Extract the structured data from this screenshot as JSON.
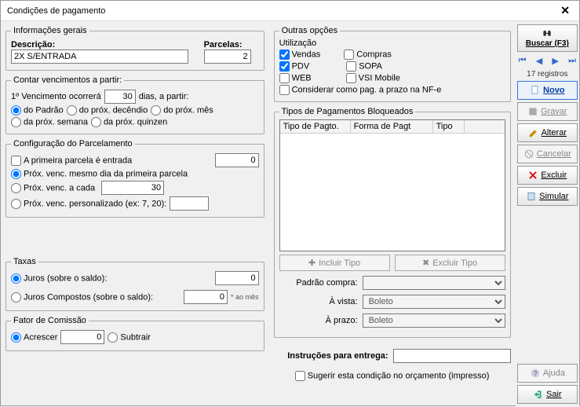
{
  "window": {
    "title": "Condições de pagamento"
  },
  "left": {
    "group_info": "Informações gerais",
    "descricao_label": "Descrição:",
    "descricao_value": "2X S/ENTRADA",
    "parcelas_label": "Parcelas:",
    "parcelas_value": "2",
    "group_contar": "Contar vencimentos a partir:",
    "primeiro_label_a": "1º Vencimento ocorrerá",
    "primeiro_days": "30",
    "primeiro_label_b": "dias, a partir:",
    "rad_padrao": "do Padrão",
    "rad_prox_dec": "do próx. decêndio",
    "rad_prox_mes": "do próx. mês",
    "rad_prox_sem": "da próx. semana",
    "rad_prox_quin": "da próx. quinzen",
    "group_parcel": "Configuração do Parcelamento",
    "chk_primeira_entrada": "A primeira parcela é entrada",
    "primeira_entrada_val": "0",
    "rad_mesmo_dia": "Próx. venc. mesmo dia da primeira parcela",
    "rad_acada": "Próx. venc. a cada",
    "acada_val": "30",
    "rad_personalizado": "Próx. venc. personalizado (ex: 7, 20):",
    "personalizado_val": "",
    "group_taxas": "Taxas",
    "rad_juros": "Juros (sobre o saldo):",
    "juros_val": "0",
    "rad_juros_comp": "Juros Compostos (sobre o saldo):",
    "juros_comp_val": "0",
    "ao_mes": "* ao mês",
    "group_fator": "Fator de Comissão",
    "rad_acrescer": "Acrescer",
    "fator_val": "0",
    "rad_subtrair": "Subtrair"
  },
  "mid": {
    "group_outras": "Outras opções",
    "utilizacao": "Utilização",
    "chk_vendas": "Vendas",
    "chk_compras": "Compras",
    "chk_pdv": "PDV",
    "chk_sopa": "SOPA",
    "chk_web": "WEB",
    "chk_vsi": "VSI Mobile",
    "chk_prazo_nfe": "Considerar como pag. a prazo na NF-e",
    "group_tipos": "Tipos de Pagamentos Bloqueados",
    "col1": "Tipo de Pagto.",
    "col2": "Forma de Pagt",
    "col3": "Tipo",
    "btn_incluir": "Incluir Tipo",
    "btn_excluir": "Excluir Tipo",
    "padrao_compra": "Padrão compra:",
    "padrao_compra_val": "",
    "a_vista": "À vista:",
    "a_vista_val": "Boleto",
    "a_prazo": "À prazo:",
    "a_prazo_val": "Boleto",
    "instr_label": "Instruções para entrega:",
    "instr_val": "",
    "chk_sugerir": "Sugerir esta condição no orçamento (impresso)"
  },
  "side": {
    "buscar": "Buscar (F3)",
    "registros": "17 registros",
    "novo": "Novo",
    "gravar": "Gravar",
    "alterar": "Alterar",
    "cancelar": "Cancelar",
    "excluir": "Excluir",
    "simular": "Simular",
    "ajuda": "Ajuda",
    "sair": "Sair"
  }
}
